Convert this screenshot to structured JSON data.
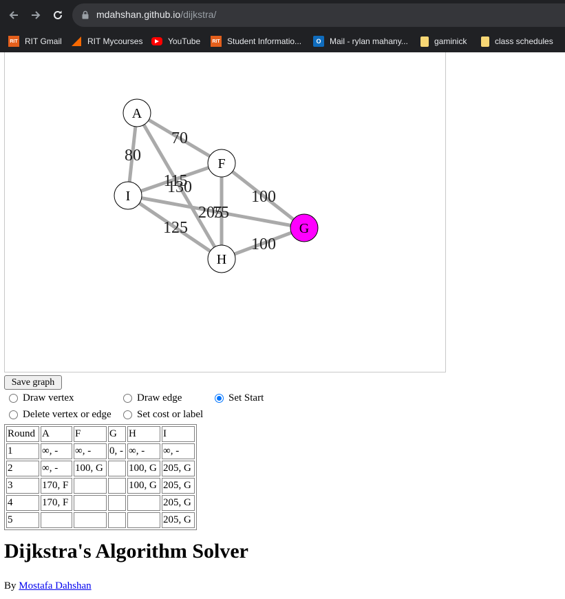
{
  "browser": {
    "url_host": "mdahshan.github.io",
    "url_path": "/dijkstra/",
    "bookmarks": [
      {
        "label": "RIT Gmail",
        "icon": "rit-icon"
      },
      {
        "label": "RIT Mycourses",
        "icon": "mycourses-icon"
      },
      {
        "label": "YouTube",
        "icon": "youtube-icon"
      },
      {
        "label": "Student Informatio...",
        "icon": "rit-icon"
      },
      {
        "label": "Mail - rylan mahany...",
        "icon": "outlook-icon"
      },
      {
        "label": "gaminick",
        "icon": "folder-icon"
      },
      {
        "label": "class schedules",
        "icon": "folder-icon"
      }
    ]
  },
  "graph": {
    "vertices": [
      {
        "id": "A",
        "fill": "#ffffff"
      },
      {
        "id": "F",
        "fill": "#ffffff"
      },
      {
        "id": "I",
        "fill": "#ffffff"
      },
      {
        "id": "G",
        "fill": "#ff00ff"
      },
      {
        "id": "H",
        "fill": "#ffffff"
      }
    ],
    "edges": [
      {
        "from": "A",
        "to": "F",
        "cost": "70"
      },
      {
        "from": "A",
        "to": "I",
        "cost": "80"
      },
      {
        "from": "A",
        "to": "H",
        "cost": "130"
      },
      {
        "from": "I",
        "to": "F",
        "cost": "115"
      },
      {
        "from": "F",
        "to": "H",
        "cost": "75"
      },
      {
        "from": "I",
        "to": "G",
        "cost": "205"
      },
      {
        "from": "F",
        "to": "G",
        "cost": "100"
      },
      {
        "from": "I",
        "to": "H",
        "cost": "125"
      },
      {
        "from": "H",
        "to": "G",
        "cost": "100"
      }
    ],
    "edge_color": "#aaaaaa",
    "start_color": "#ff00ff"
  },
  "controls": {
    "save_label": "Save graph",
    "options": [
      {
        "label": "Draw vertex",
        "checked": false
      },
      {
        "label": "Draw edge",
        "checked": false
      },
      {
        "label": "Set Start",
        "checked": true
      },
      {
        "label": "Delete vertex or edge",
        "checked": false
      },
      {
        "label": "Set cost or label",
        "checked": false
      }
    ]
  },
  "table": {
    "headers": [
      "Round",
      "A",
      "F",
      "G",
      "H",
      "I"
    ],
    "rows": [
      [
        "1",
        "∞, -",
        "∞, -",
        "0, -",
        "∞, -",
        "∞, -"
      ],
      [
        "2",
        "∞, -",
        "100, G",
        "",
        "100, G",
        "205, G"
      ],
      [
        "3",
        "170, F",
        "",
        "",
        "100, G",
        "205, G"
      ],
      [
        "4",
        "170, F",
        "",
        "",
        "",
        "205, G"
      ],
      [
        "5",
        "",
        "",
        "",
        "",
        "205, G"
      ]
    ]
  },
  "page": {
    "title": "Dijkstra's Algorithm Solver",
    "byline_prefix": "By",
    "author": "Mostafa Dahshan"
  }
}
